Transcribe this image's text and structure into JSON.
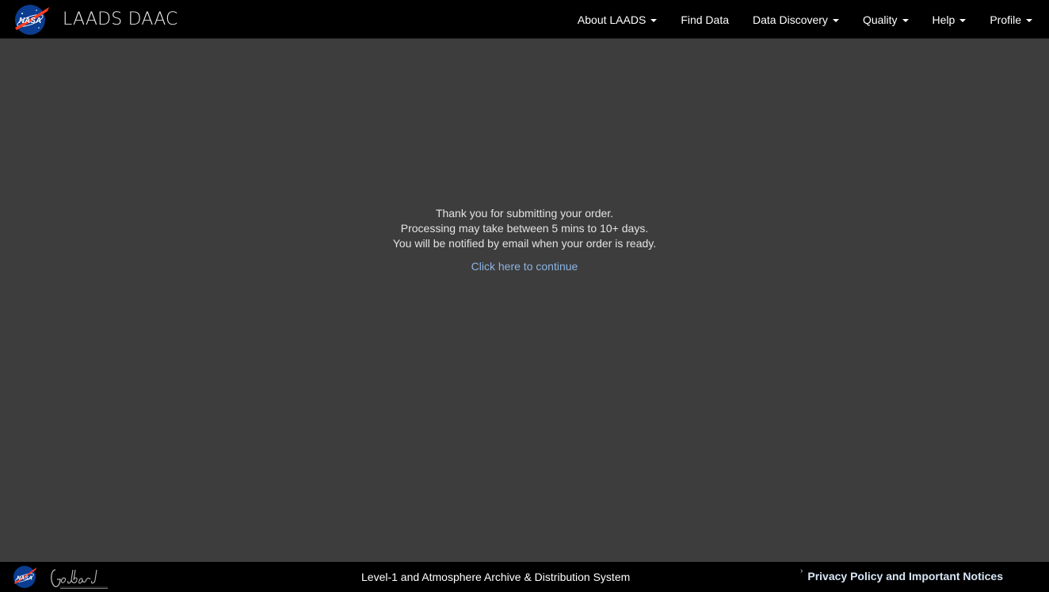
{
  "header": {
    "brand_title": "LAADS DAAC",
    "nav": [
      {
        "label": "About LAADS",
        "has_dropdown": true
      },
      {
        "label": "Find Data",
        "has_dropdown": false
      },
      {
        "label": "Data Discovery",
        "has_dropdown": true
      },
      {
        "label": "Quality",
        "has_dropdown": true
      },
      {
        "label": "Help",
        "has_dropdown": true
      },
      {
        "label": "Profile",
        "has_dropdown": true
      }
    ]
  },
  "main": {
    "message_lines": [
      "Thank you for submitting your order.",
      "Processing may take between 5 mins to 10+ days.",
      "You will be notified by email when your order is ready."
    ],
    "continue_link": "Click here to continue"
  },
  "footer": {
    "center_text": "Level-1 and Atmosphere Archive & Distribution System",
    "privacy_link": "Privacy Policy and Important Notices"
  },
  "icons": {
    "logo": "nasa-meatball-icon",
    "caret": "caret-down-icon",
    "footer_logo_1": "nasa-meatball-icon",
    "footer_logo_2": "goddard-logo-icon",
    "chevron": "chevron-right-icon"
  },
  "colors": {
    "navbar_bg": "#000000",
    "content_bg": "#3d3d3d",
    "link": "#8cb4e2",
    "text": "#e3e3e3"
  }
}
